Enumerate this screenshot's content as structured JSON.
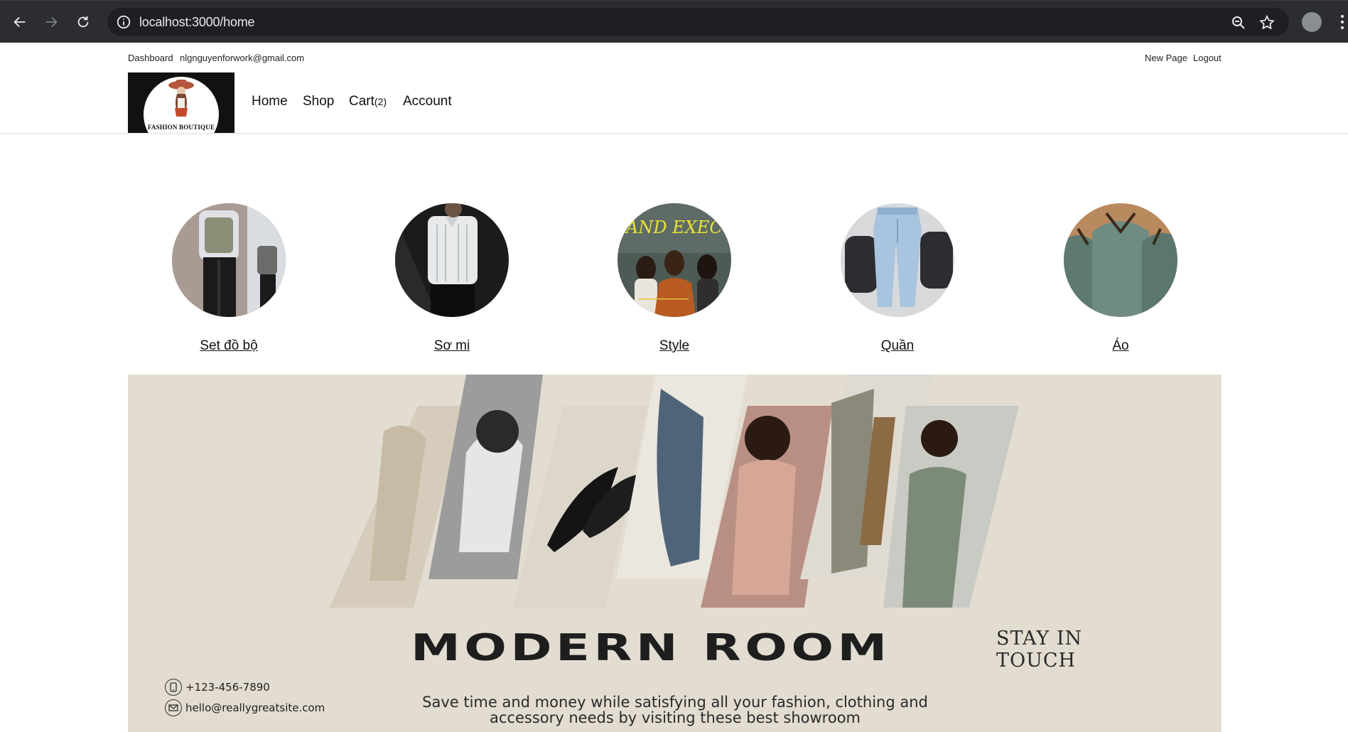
{
  "browser": {
    "url": "localhost:3000/home"
  },
  "topbar": {
    "dashboard": "Dashboard",
    "email": "nlgnguyenforwork@gmail.com",
    "new_page": "New Page",
    "logout": "Logout"
  },
  "logo": {
    "text": "FASHION BOUTIQUE"
  },
  "nav": {
    "home": "Home",
    "shop": "Shop",
    "cart": "Cart",
    "cart_count": "(2)",
    "account": "Account"
  },
  "categories": [
    {
      "label": "Set đồ bộ"
    },
    {
      "label": "Sơ mi"
    },
    {
      "label": "Style",
      "image_text": "AND EXECU"
    },
    {
      "label": "Quần"
    },
    {
      "label": "Áo"
    }
  ],
  "banner": {
    "title": "MODERN ROOM",
    "stay": "STAY IN",
    "touch": "TOUCH",
    "description_line1": "Save time and money while satisfying all your fashion, clothing and",
    "description_line2": "accessory needs by visiting these best showroom",
    "phone": "+123-456-7890",
    "email": "hello@reallygreatsite.com"
  },
  "colors": {
    "browser_bg": "#2b2d30",
    "omnibox_bg": "#1e1f22",
    "banner_bg": "#e3dcd1",
    "text": "#111111"
  }
}
